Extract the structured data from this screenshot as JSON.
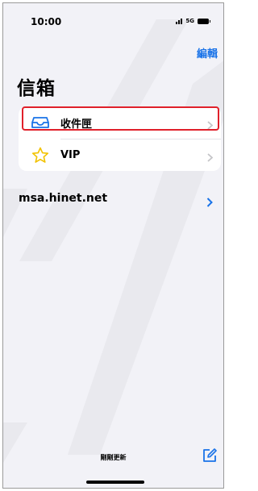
{
  "status_bar": {
    "time": "10:00",
    "network": "5G",
    "icons": [
      "signal-icon",
      "battery-icon"
    ]
  },
  "header": {
    "edit_label": "編輯",
    "title": "信箱"
  },
  "mailboxes": [
    {
      "label": "收件匣",
      "icon": "tray-icon",
      "highlighted": true
    },
    {
      "label": "VIP",
      "icon": "star-icon",
      "highlighted": false
    }
  ],
  "account": {
    "name": "msa.hinet.net"
  },
  "footer": {
    "status": "剛剛更新",
    "compose_icon": "compose-icon"
  },
  "colors": {
    "accent": "#1a73e8",
    "highlight": "#e0202a",
    "star": "#f2c200",
    "background": "#f2f2f7"
  }
}
